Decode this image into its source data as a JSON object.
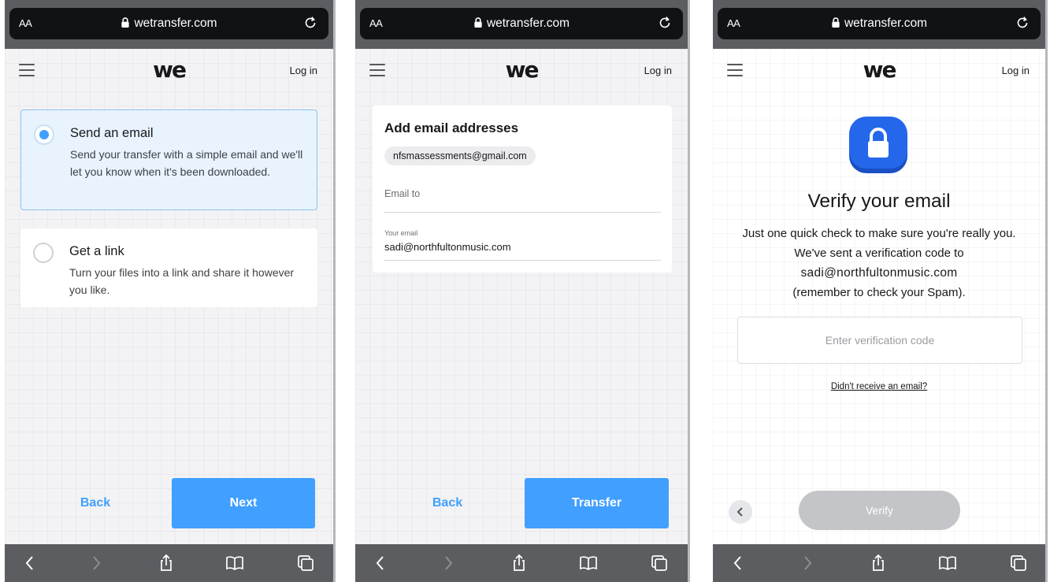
{
  "browser": {
    "text_size_button": "AA",
    "url": "wetransfer.com"
  },
  "header": {
    "logo": "we",
    "login": "Log in"
  },
  "panel1": {
    "options": [
      {
        "title": "Send an email",
        "description": "Send your transfer with a simple email and we'll let you know when it's been downloaded.",
        "selected": true
      },
      {
        "title": "Get a link",
        "description": "Turn your files into a link and share it however you like.",
        "selected": false
      }
    ],
    "back_label": "Back",
    "next_label": "Next"
  },
  "panel2": {
    "card_title": "Add email addresses",
    "recipient_chip": "nfsmassessments@gmail.com",
    "email_to_placeholder": "Email to",
    "your_email_label": "Your email",
    "your_email_value": "sadi@northfultonmusic.com",
    "back_label": "Back",
    "transfer_label": "Transfer"
  },
  "panel3": {
    "title": "Verify your email",
    "body_line1": "Just one quick check to make sure you're really you. We've sent a verification code to",
    "email": "sadi@northfultonmusic.com",
    "body_line2": "(remember to check your Spam).",
    "code_placeholder": "Enter verification code",
    "resend_link": "Didn't receive an email?",
    "verify_label": "Verify"
  },
  "colors": {
    "accent": "#409fff",
    "selected_bg": "#e8f3fd",
    "lock_badge": "#1f5fe0",
    "disabled": "#c4c5c8",
    "chrome": "#5c5d61"
  },
  "icons": [
    "lock-icon",
    "reload-icon",
    "hamburger-icon",
    "back-arrow-icon",
    "forward-arrow-icon",
    "share-icon",
    "bookmarks-icon",
    "tabs-icon",
    "padlock-badge-icon",
    "chevron-left-icon"
  ]
}
